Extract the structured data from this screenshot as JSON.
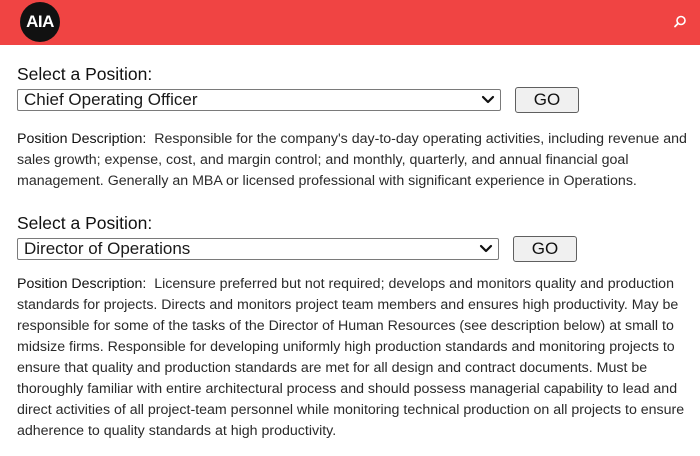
{
  "header": {
    "logo_text": "AIA",
    "brand_color": "#f04443",
    "search_icon": "search-icon"
  },
  "positions": [
    {
      "select_label": "Select a Position:",
      "selected_value": "Chief Operating Officer",
      "go_label": "GO",
      "description_label": "Position Description:",
      "description_text": "Responsible for the company's day-to-day operating activities, including revenue and sales growth; expense, cost, and margin control; and monthly, quarterly, and annual financial goal management. Generally an MBA or licensed professional with significant experience in Operations."
    },
    {
      "select_label": "Select a Position:",
      "selected_value": "Director of Operations",
      "go_label": "GO",
      "description_label": "Position Description:",
      "description_text": "Licensure preferred but not required; develops and monitors quality and production standards for projects. Directs and monitors project team members and ensures high productivity. May be responsible for some of the tasks of the Director of Human Resources (see description below) at small to midsize firms. Responsible for developing uniformly high production standards and monitoring projects to ensure that quality and production standards are met for all design and contract documents. Must be thoroughly familiar with entire architectural process and should possess managerial capability to lead and direct activities of all project-team personnel while monitoring technical production on all projects to ensure adherence to quality standards at high productivity."
    }
  ]
}
